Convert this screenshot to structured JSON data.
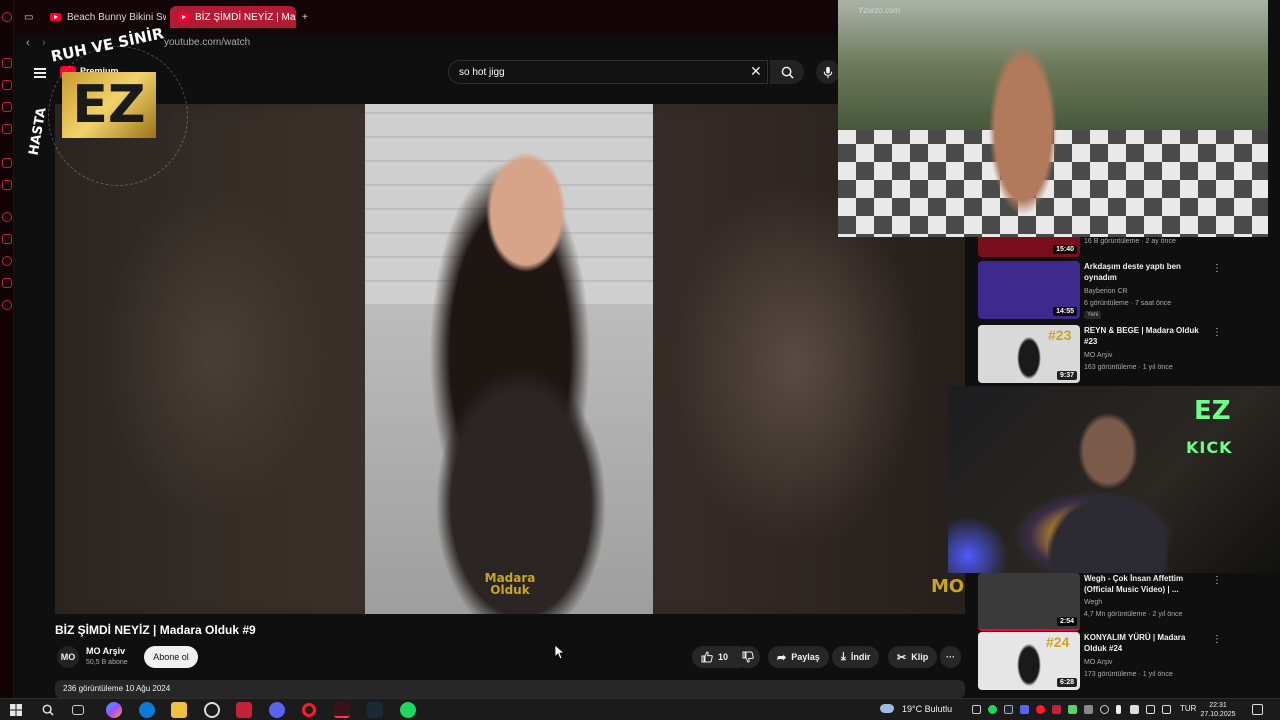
{
  "browser": {
    "tabs": [
      {
        "label": "Beach Bunny Bikini Swim",
        "active": false
      },
      {
        "label": "BİZ ŞİMDİ NEYİZ | Ma",
        "active": true
      }
    ],
    "new_tab_label": "+",
    "url": "youtube.com/watch"
  },
  "youtube": {
    "logo": "Premium",
    "search_value": "so hot jigg",
    "clear_label": "✕",
    "video_title": "BİZ ŞİMDİ NEYİZ | Madara Olduk #9",
    "video_watermark": "Madara Olduk",
    "corner_watermark": "MO",
    "channel": {
      "name": "MO Arşiv",
      "subs": "50,5 B abone",
      "avatar": "MO"
    },
    "subscribe_label": "Abone ol",
    "likes": "10",
    "share_label": "Paylaş",
    "download_label": "İndir",
    "clip_label": "Klip",
    "more_label": "···",
    "description": "236 görüntüleme  10 Ağu 2024"
  },
  "related": [
    {
      "meta": "16 B görüntüleme · 2 ay önce",
      "duration": "15:40",
      "thumb_color": "#7a0f1c"
    },
    {
      "title": "Arkdaşım deste yaptı ben oynadım",
      "channel": "Bayberion CR",
      "meta": "6 görüntüleme · 7 saat önce",
      "badge": "Yeni",
      "duration": "14:55",
      "thumb_color": "#3d2a8c"
    },
    {
      "title": "REYN & BEGE | Madara Olduk #23",
      "channel": "MO Arşiv",
      "meta": "163 görüntüleme · 1 yıl önce",
      "duration": "9:37",
      "thumb_color": "#d9d9d9",
      "overlay": "#23"
    },
    {
      "title": "Wegh - Çok İnsan Affettim (Official Music Video) | ...",
      "channel": "Wegh",
      "meta": "4,7 Mn görüntüleme · 2 yıl önce",
      "duration": "2:54",
      "thumb_color": "#3a3a3a"
    },
    {
      "title": "KONYALIM YÜRÜ | Madara Olduk #24",
      "channel": "MO Arşiv",
      "meta": "173 görüntüleme · 1 yıl önce",
      "duration": "6:28",
      "thumb_color": "#e6e6e6",
      "overlay": "#24"
    }
  ],
  "overlays": {
    "logo_top_text": "RUH VE SİNİR",
    "logo_side_text": "HASTA",
    "logo_letters": "EZ",
    "kick_logo": "EZ",
    "kick_label": "KICK",
    "cam_watermark": "Yzorzo.com"
  },
  "taskbar": {
    "weather": "19°C  Bulutlu",
    "lang": "TUR",
    "time": "22:31",
    "date": "27.10.2025"
  },
  "colors": {
    "accent": "#b31a34",
    "youtube_red": "#ff0033",
    "kick_green": "#6dff8c",
    "gold": "#c7a526"
  }
}
